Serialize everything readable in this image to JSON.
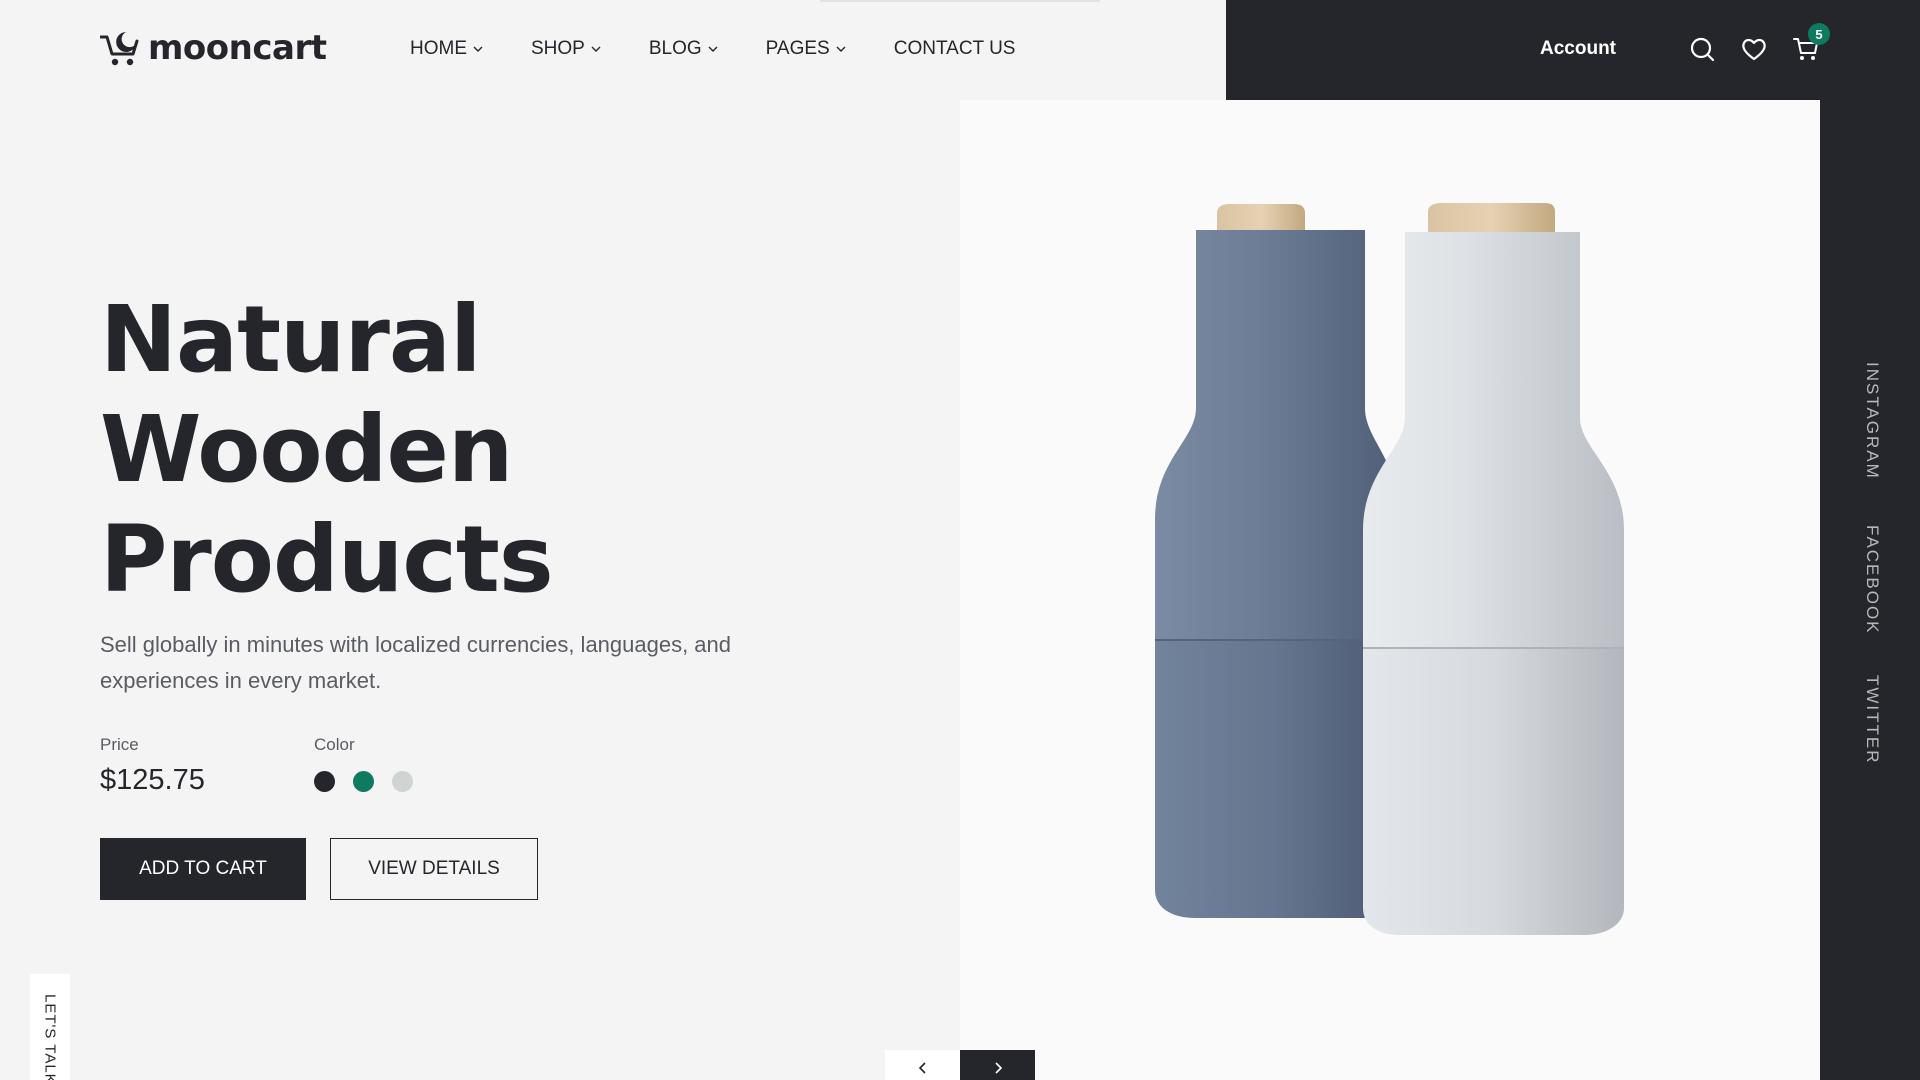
{
  "brand": {
    "name": "mooncart",
    "logo_icon": "moon-cart-logo"
  },
  "nav": {
    "items": [
      {
        "label": "HOME",
        "has_dropdown": true
      },
      {
        "label": "SHOP",
        "has_dropdown": true
      },
      {
        "label": "BLOG",
        "has_dropdown": true
      },
      {
        "label": "PAGES",
        "has_dropdown": true
      },
      {
        "label": "CONTACT US",
        "has_dropdown": false
      }
    ]
  },
  "header": {
    "account_label": "Account",
    "icons": [
      "search-icon",
      "heart-icon",
      "cart-icon"
    ],
    "cart_count": "5"
  },
  "hero": {
    "title_line1": "Natural",
    "title_line2": "Wooden",
    "title_line3": "Products",
    "subtitle": "Sell globally in minutes with localized currencies, languages, and experiences in every market.",
    "price_label": "Price",
    "price_value": "$125.75",
    "color_label": "Color",
    "colors": [
      "#25262b",
      "#0e7a5f",
      "#cfd3d2"
    ],
    "add_to_cart_label": "ADD TO CART",
    "view_details_label": "VIEW DETAILS"
  },
  "social": {
    "links": [
      "INSTAGRAM",
      "FACEBOOK",
      "TWITTER"
    ]
  },
  "lets_talk": "LET'S TALK",
  "slider": {
    "prev_icon": "chevron-left-icon",
    "next_icon": "chevron-right-icon"
  },
  "theme": {
    "dark": "#25262b",
    "accent": "#0e7a5f",
    "background": "#f4f4f4"
  }
}
